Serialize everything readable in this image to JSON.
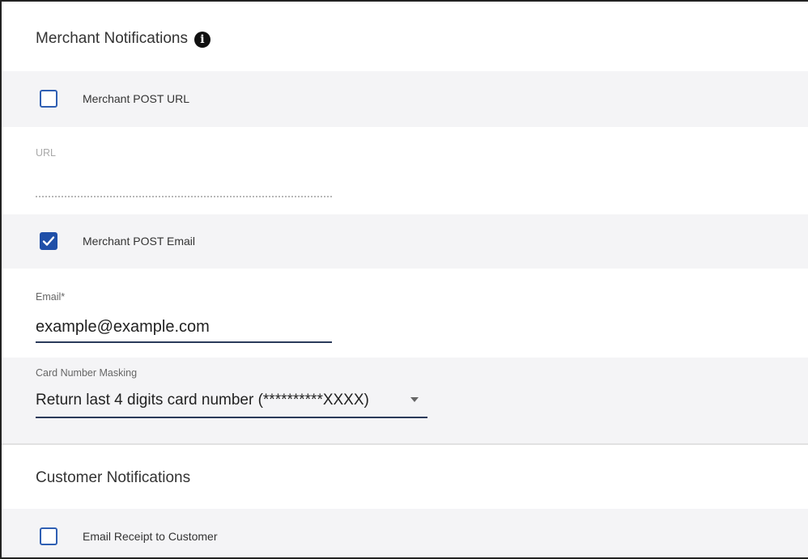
{
  "merchant_section": {
    "title": "Merchant Notifications",
    "info_icon": "info-icon"
  },
  "merchant_post_url": {
    "label": "Merchant POST URL",
    "checked": false
  },
  "url_field": {
    "label": "URL",
    "value": ""
  },
  "merchant_post_email": {
    "label": "Merchant POST Email",
    "checked": true
  },
  "email_field": {
    "label": "Email*",
    "value": "example@example.com"
  },
  "card_masking": {
    "label": "Card Number Masking",
    "selected": "Return last 4 digits card number (**********XXXX)"
  },
  "customer_section": {
    "title": "Customer Notifications"
  },
  "email_receipt": {
    "label": "Email Receipt to Customer",
    "checked": false
  },
  "colors": {
    "accent": "#1f4fa8",
    "band": "#f4f4f6"
  }
}
